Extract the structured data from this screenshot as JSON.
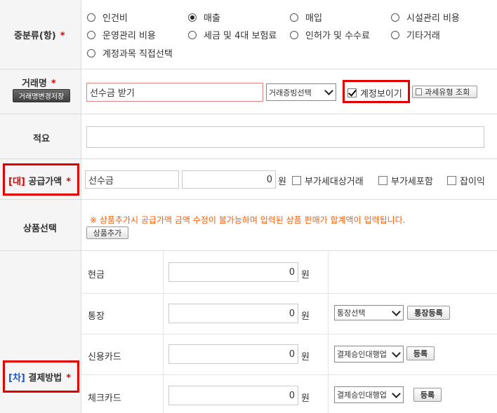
{
  "colors": {
    "required": "#e00000",
    "notice": "#ff5a00",
    "tag_dae": "#e00000",
    "tag_cha": "#1a56c8"
  },
  "category": {
    "label": "중분류(항)",
    "required_mark": "*",
    "options": [
      "인건비",
      "매출",
      "매입",
      "시설관리 비용",
      "운영관리 비용",
      "세금 및 4대 보험료",
      "인허가 및 수수료",
      "기타거래",
      "계정과목 직접선택"
    ],
    "selected": "매출"
  },
  "deal": {
    "label": "거래명",
    "required_mark": "*",
    "save_btn": "거래명변경저장",
    "name_value": "선수금 받기",
    "evidence_select": "거래증빙선택",
    "show_account_label": "계정보이기",
    "show_account_checked": true,
    "tax_lookup_btn": "과세유형 조회"
  },
  "memo": {
    "label": "적요",
    "value": ""
  },
  "supply": {
    "tag": "[대]",
    "label": "공급가액",
    "required_mark": "*",
    "account": "선수금",
    "amount": "0",
    "unit": "원",
    "vat_exempt_label": "부가세대상거래",
    "vat_included_label": "부가세포함",
    "misc_income_label": "잡이익"
  },
  "product": {
    "label": "상품선택",
    "notice": "※ 상품추가시 공급가액 금액 수정이 불가능하며 입력된 상품 판매가 합계액이 입력됩니다.",
    "add_btn": "상품추가"
  },
  "payment": {
    "tag": "[차]",
    "label": "결제방법",
    "required_mark": "*",
    "rows": [
      {
        "label": "현금",
        "amount": "0",
        "unit": "원"
      },
      {
        "label": "통장",
        "amount": "0",
        "unit": "원",
        "select": "통장선택",
        "btn": "통장등록"
      },
      {
        "label": "신용카드",
        "amount": "0",
        "unit": "원",
        "select": "결제승인대행업",
        "btn": "등록"
      },
      {
        "label": "체크카드",
        "amount": "0",
        "unit": "원",
        "select": "결제승인대행업",
        "btn": "등록"
      }
    ]
  }
}
